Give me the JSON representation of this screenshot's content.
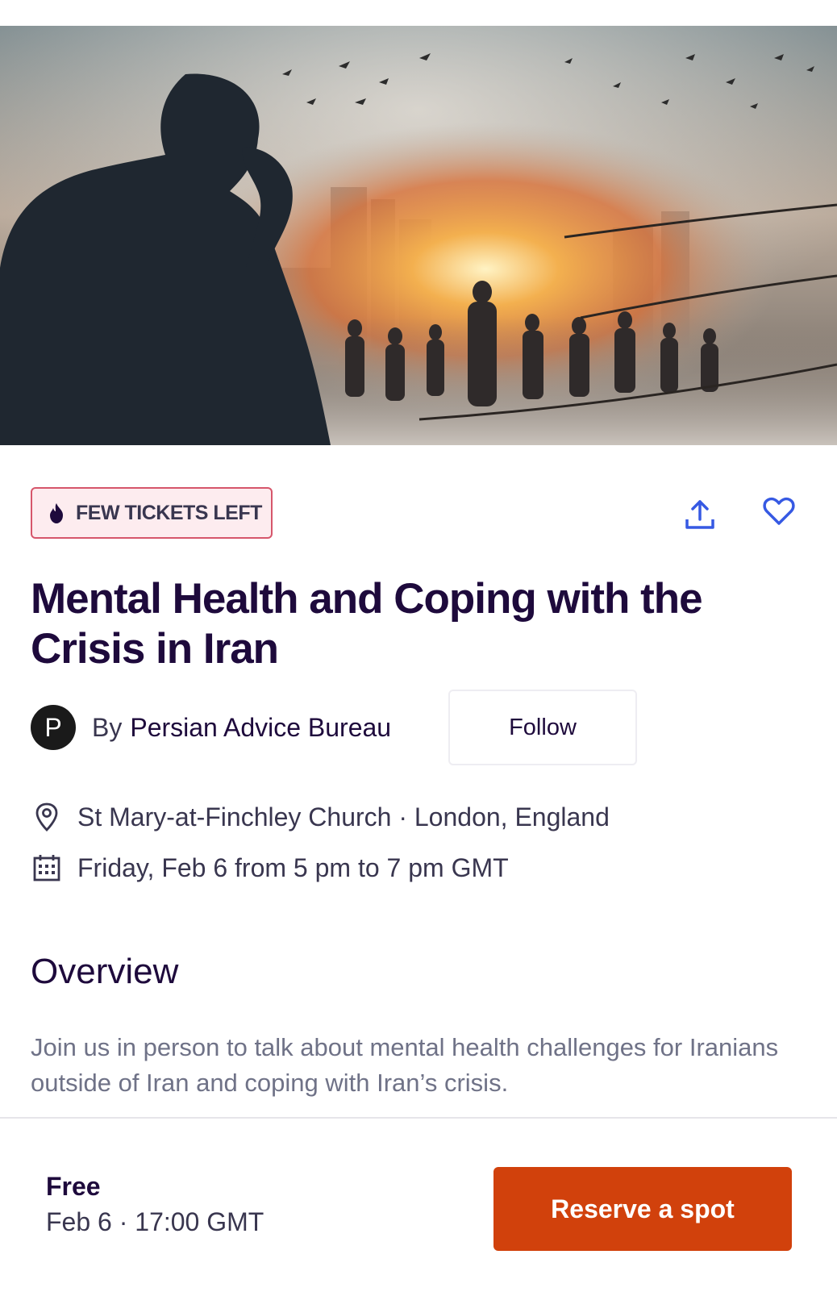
{
  "hero": {
    "image_icon": "hero-illustration"
  },
  "badge": {
    "label": "FEW TICKETS LEFT",
    "icon": "flame-icon",
    "color": "#d6566b"
  },
  "actions": {
    "share_icon": "share-icon",
    "like_icon": "heart-icon",
    "accent": "#3659e3"
  },
  "event": {
    "title": "Mental Health and Coping with the Crisis in Iran",
    "organizer": {
      "avatar_letter": "P",
      "by_label": "By",
      "name": "Persian Advice Bureau",
      "follow_label": "Follow"
    },
    "location": "St Mary-at-Finchley Church · London, England",
    "datetime": "Friday, Feb 6 from 5 pm to 7 pm GMT"
  },
  "overview": {
    "heading": "Overview",
    "text": "Join us in person to talk about mental health challenges for Iranians outside of Iran and coping with Iran’s crisis."
  },
  "footer": {
    "price": "Free",
    "date_time": "Feb 6 · 17:00 GMT",
    "reserve_label": "Reserve a spot",
    "reserve_color": "#d1410c"
  }
}
